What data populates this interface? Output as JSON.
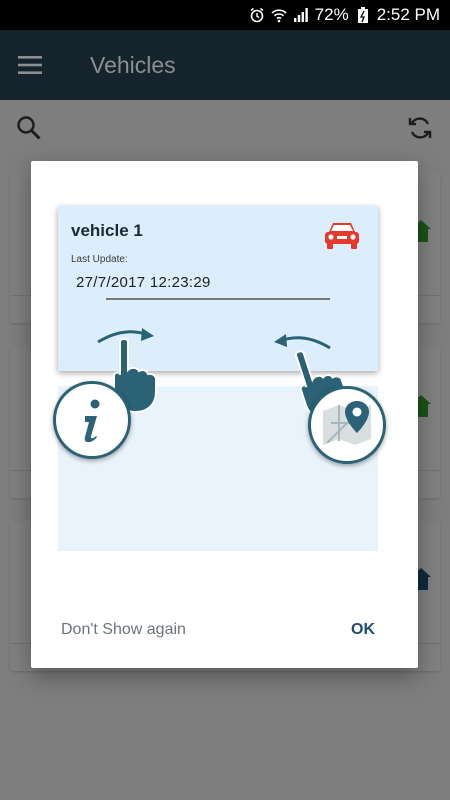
{
  "status_bar": {
    "battery": "72%",
    "time": "2:52 PM"
  },
  "app_bar": {
    "title": "Vehicles",
    "menu_icon": "hamburger-menu-icon"
  },
  "toolbar": {
    "search_icon": "search-icon",
    "refresh_icon": "refresh-icon"
  },
  "dialog": {
    "vehicle_name": "vehicle 1",
    "last_update_label": "Last Update:",
    "last_update_value": "27/7/2017 12:23:29",
    "info_icon": "info-icon",
    "map_icon": "map-pin-icon",
    "dont_show_label": "Don't Show again",
    "ok_label": "OK"
  },
  "colors": {
    "app_bar": "#14232c",
    "accent": "#1b4e72",
    "car_icon": "#e53a2b",
    "card_bg": "#dceefb"
  }
}
